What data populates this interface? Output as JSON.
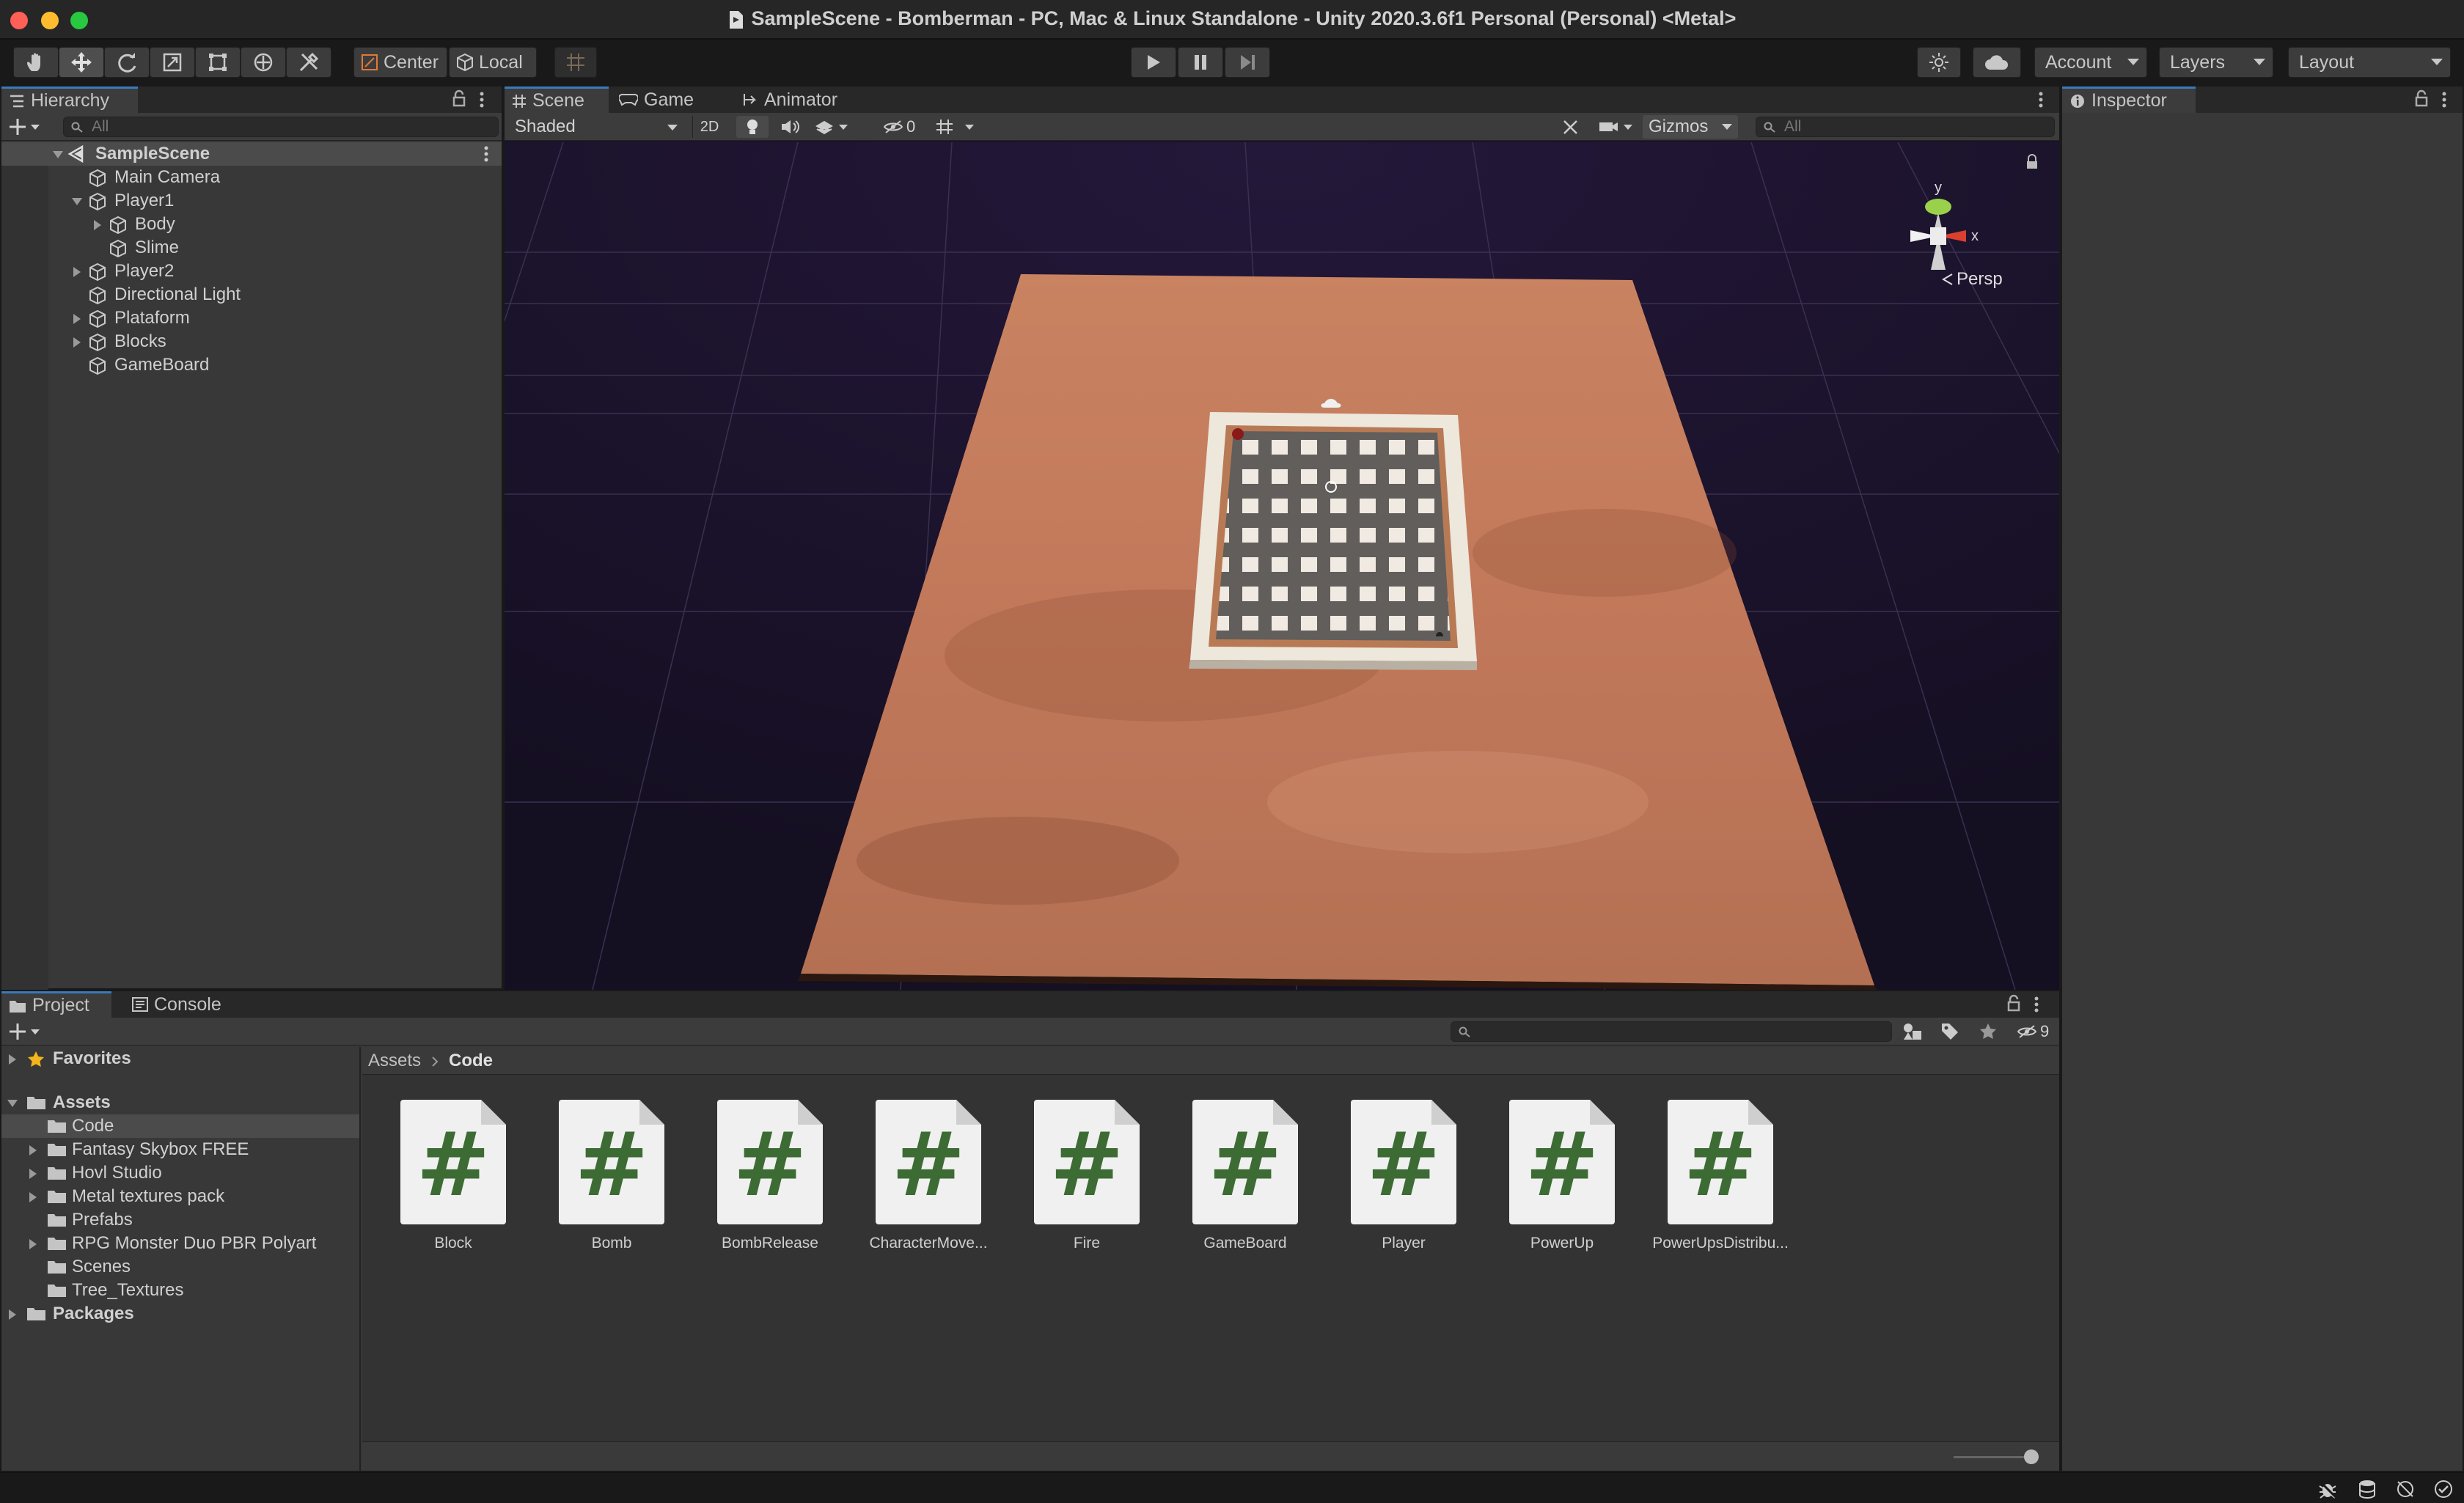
{
  "window": {
    "title": "SampleScene - Bomberman - PC, Mac & Linux Standalone - Unity 2020.3.6f1 Personal (Personal) <Metal>"
  },
  "toolbar": {
    "pivot_label": "Center",
    "space_label": "Local",
    "account_label": "Account",
    "layers_label": "Layers",
    "layout_label": "Layout"
  },
  "hierarchy": {
    "tab_label": "Hierarchy",
    "search_placeholder": "All",
    "items": [
      {
        "label": "SampleScene"
      },
      {
        "label": "Main Camera"
      },
      {
        "label": "Player1"
      },
      {
        "label": "Body"
      },
      {
        "label": "Slime"
      },
      {
        "label": "Player2"
      },
      {
        "label": "Directional Light"
      },
      {
        "label": "Plataform"
      },
      {
        "label": "Blocks"
      },
      {
        "label": "GameBoard"
      }
    ]
  },
  "scene": {
    "tabs": [
      {
        "label": "Scene"
      },
      {
        "label": "Game"
      },
      {
        "label": "Animator"
      }
    ],
    "shading_mode": "Shaded",
    "mode_2d": "2D",
    "hidden_count": "0",
    "gizmos_label": "Gizmos",
    "search_placeholder": "All",
    "axis_y": "y",
    "axis_x": "x",
    "projection": "Persp"
  },
  "inspector": {
    "tab_label": "Inspector"
  },
  "project": {
    "tabs": [
      {
        "label": "Project"
      },
      {
        "label": "Console"
      }
    ],
    "hidden_count": "9",
    "tree": [
      {
        "label": "Favorites"
      },
      {
        "label": "Assets"
      },
      {
        "label": "Code"
      },
      {
        "label": "Fantasy Skybox FREE"
      },
      {
        "label": "Hovl Studio"
      },
      {
        "label": "Metal textures pack"
      },
      {
        "label": "Prefabs"
      },
      {
        "label": "RPG Monster Duo PBR Polyart"
      },
      {
        "label": "Scenes"
      },
      {
        "label": "Tree_Textures"
      },
      {
        "label": "Packages"
      }
    ],
    "breadcrumb": [
      {
        "label": "Assets"
      },
      {
        "label": "Code"
      }
    ],
    "assets": [
      {
        "label": "Block"
      },
      {
        "label": "Bomb"
      },
      {
        "label": "BombRelease"
      },
      {
        "label": "CharacterMove..."
      },
      {
        "label": "Fire"
      },
      {
        "label": "GameBoard"
      },
      {
        "label": "Player"
      },
      {
        "label": "PowerUp"
      },
      {
        "label": "PowerUpsDistribu..."
      }
    ]
  },
  "colors": {
    "accent": "#3a79bb",
    "script_hash": "#3d6b34"
  }
}
